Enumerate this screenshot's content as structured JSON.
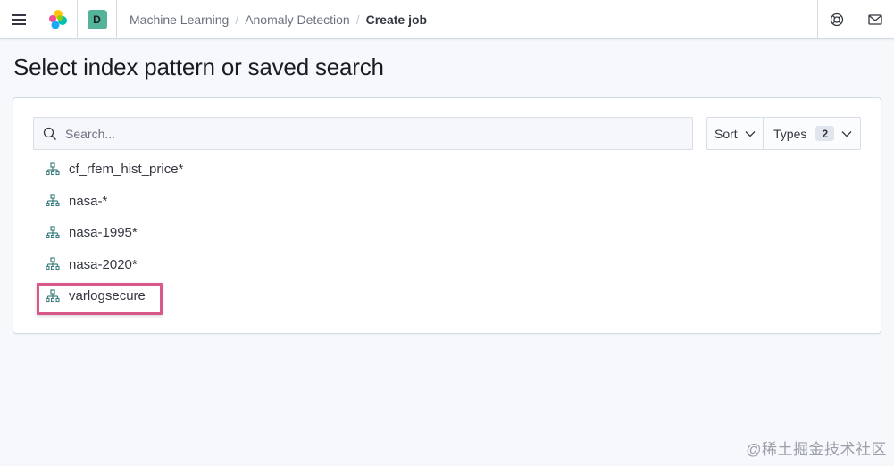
{
  "header": {
    "space_initial": "D",
    "breadcrumbs": [
      "Machine Learning",
      "Anomaly Detection",
      "Create job"
    ]
  },
  "page": {
    "title": "Select index pattern or saved search"
  },
  "search": {
    "placeholder": "Search...",
    "value": ""
  },
  "filters": {
    "sort_label": "Sort",
    "types_label": "Types",
    "types_count": "2"
  },
  "items": [
    {
      "label": "cf_rfem_hist_price*",
      "icon": "index-pattern-icon"
    },
    {
      "label": "nasa-*",
      "icon": "index-pattern-icon"
    },
    {
      "label": "nasa-1995*",
      "icon": "index-pattern-icon"
    },
    {
      "label": "nasa-2020*",
      "icon": "index-pattern-icon"
    },
    {
      "label": "varlogsecure",
      "icon": "index-pattern-icon",
      "highlighted": true
    }
  ],
  "watermark": "@稀土掘金技术社区",
  "colors": {
    "accent_highlight": "#d9578a",
    "space_badge": "#54b399",
    "icon_teal": "#3f7f7f"
  }
}
